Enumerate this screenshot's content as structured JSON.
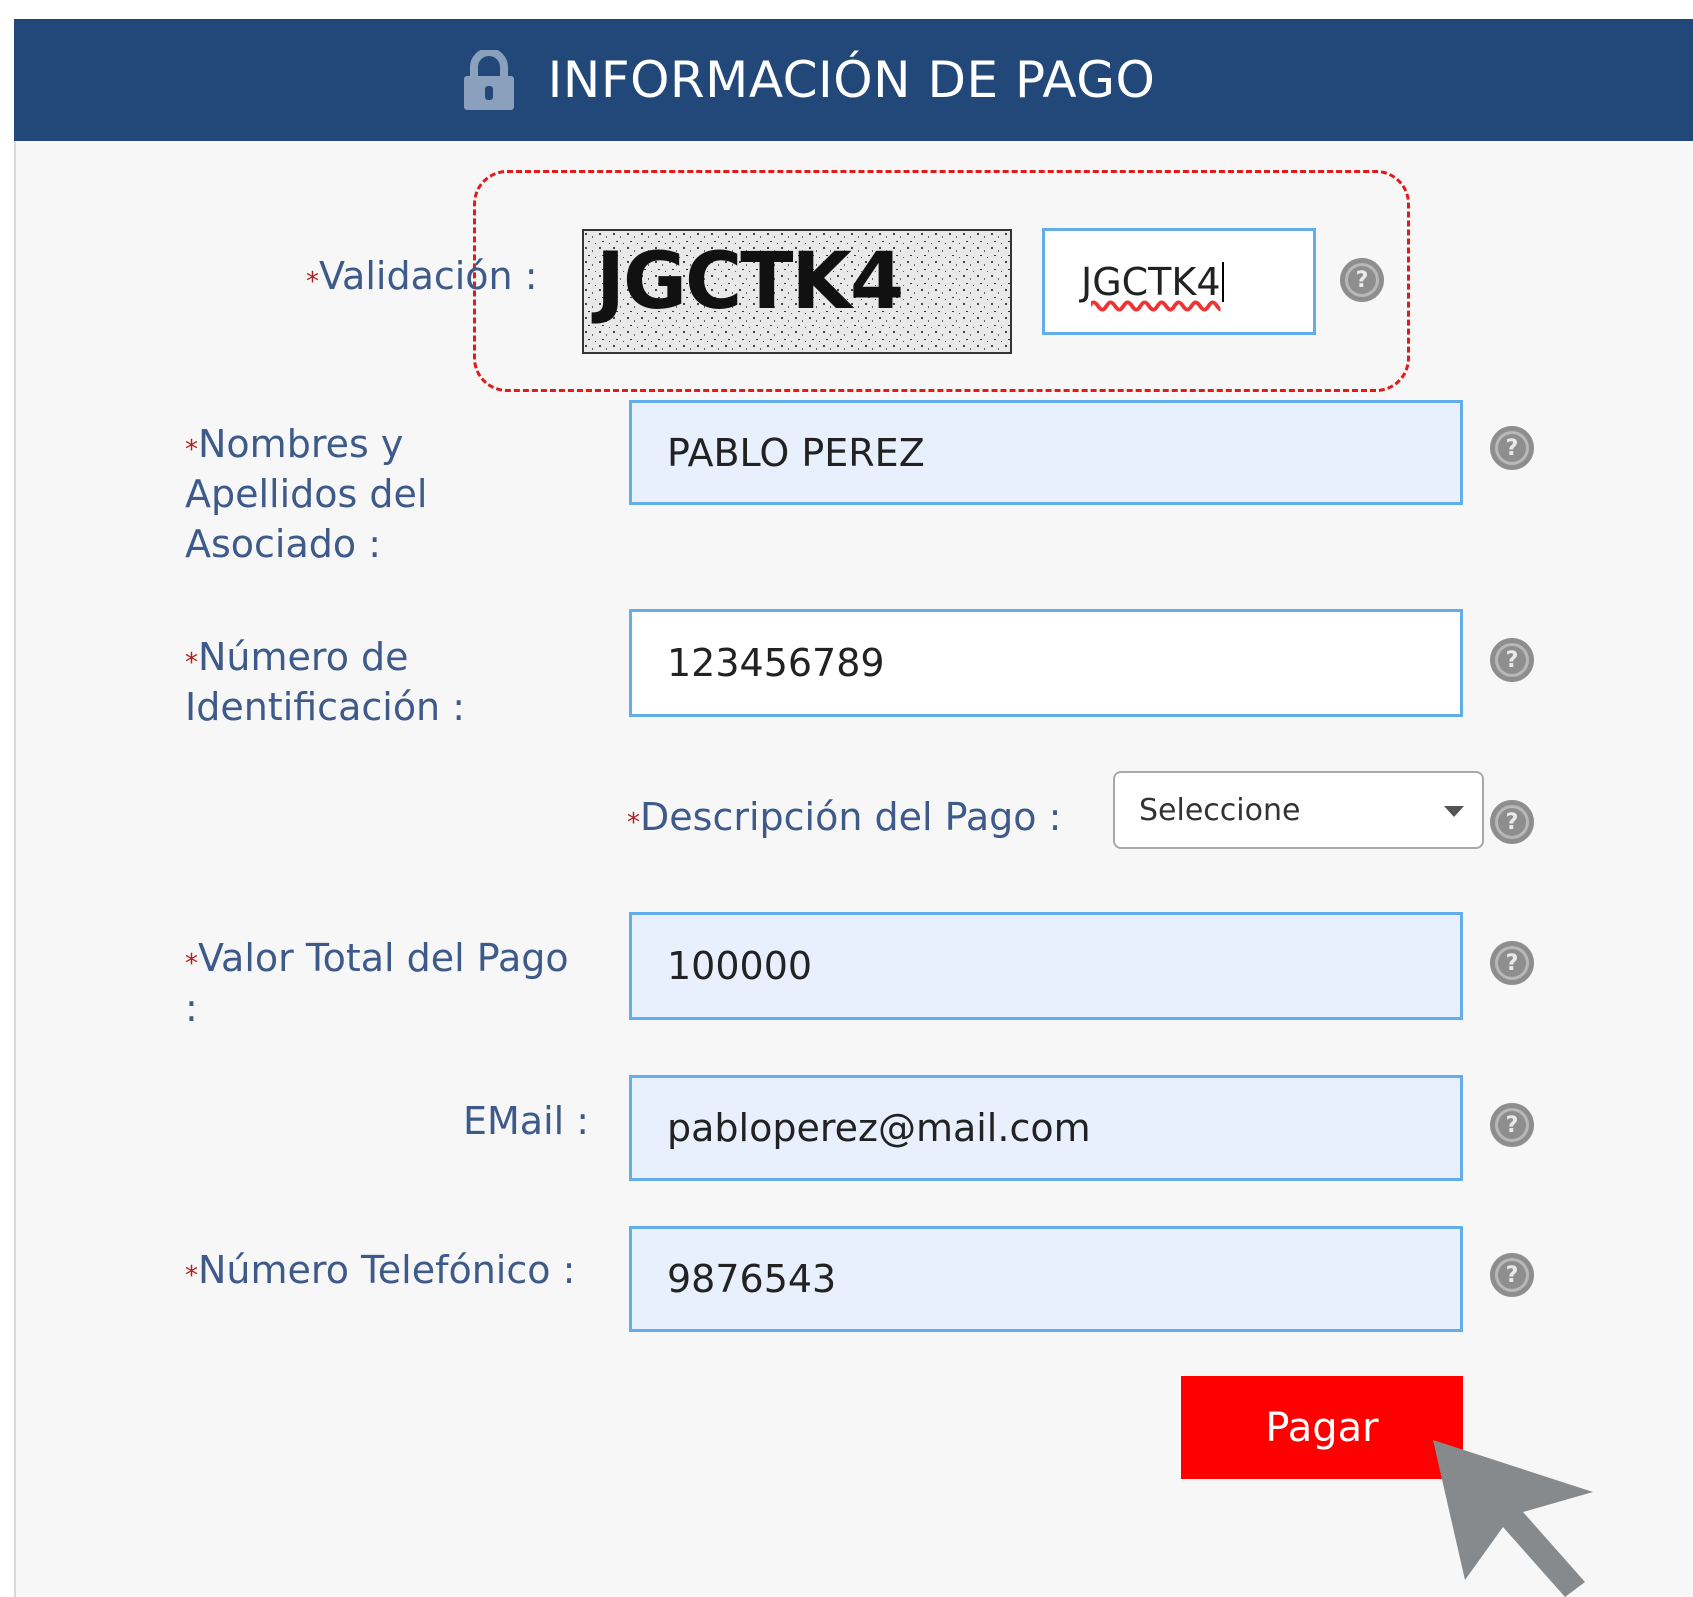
{
  "header": {
    "title": "INFORMACIÓN DE PAGO",
    "icon": "lock-icon"
  },
  "form": {
    "required_mark": "*",
    "validacion": {
      "label": "Validación :",
      "captcha_text": "JGCTK4",
      "value": "JGCTK4"
    },
    "nombres": {
      "label_line1": "Nombres y",
      "label_line2": "Apellidos del",
      "label_line3": "Asociado :",
      "value": "PABLO PEREZ"
    },
    "identificacion": {
      "label_line1": "Número de",
      "label_line2": "Identificación :",
      "value": "123456789"
    },
    "descripcion": {
      "label": "Descripción del Pago :",
      "selected": "Seleccione"
    },
    "valor": {
      "label_line1": "Valor Total del Pago",
      "label_line2": ":",
      "value": "100000"
    },
    "email": {
      "label": "EMail :",
      "value": "pabloperez@mail.com"
    },
    "telefono": {
      "label": "Número Telefónico :",
      "value": "9876543"
    },
    "help_glyph": "?",
    "submit_label": "Pagar"
  },
  "colors": {
    "header_bg": "#214878",
    "label": "#3d5a8a",
    "field_border": "#62aeea",
    "field_bg": "#e8f0fd",
    "submit_bg": "#ff0000",
    "highlight": "#e01b1b"
  }
}
